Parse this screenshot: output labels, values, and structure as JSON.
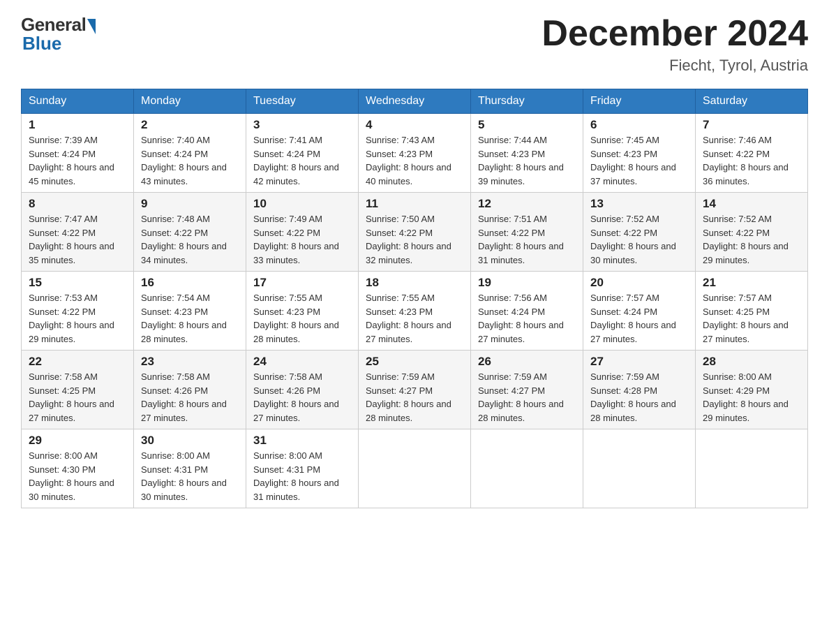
{
  "header": {
    "logo": {
      "general": "General",
      "blue": "Blue"
    },
    "title": "December 2024",
    "location": "Fiecht, Tyrol, Austria"
  },
  "days_of_week": [
    "Sunday",
    "Monday",
    "Tuesday",
    "Wednesday",
    "Thursday",
    "Friday",
    "Saturday"
  ],
  "weeks": [
    [
      {
        "day": "1",
        "sunrise": "7:39 AM",
        "sunset": "4:24 PM",
        "daylight": "8 hours and 45 minutes."
      },
      {
        "day": "2",
        "sunrise": "7:40 AM",
        "sunset": "4:24 PM",
        "daylight": "8 hours and 43 minutes."
      },
      {
        "day": "3",
        "sunrise": "7:41 AM",
        "sunset": "4:24 PM",
        "daylight": "8 hours and 42 minutes."
      },
      {
        "day": "4",
        "sunrise": "7:43 AM",
        "sunset": "4:23 PM",
        "daylight": "8 hours and 40 minutes."
      },
      {
        "day": "5",
        "sunrise": "7:44 AM",
        "sunset": "4:23 PM",
        "daylight": "8 hours and 39 minutes."
      },
      {
        "day": "6",
        "sunrise": "7:45 AM",
        "sunset": "4:23 PM",
        "daylight": "8 hours and 37 minutes."
      },
      {
        "day": "7",
        "sunrise": "7:46 AM",
        "sunset": "4:22 PM",
        "daylight": "8 hours and 36 minutes."
      }
    ],
    [
      {
        "day": "8",
        "sunrise": "7:47 AM",
        "sunset": "4:22 PM",
        "daylight": "8 hours and 35 minutes."
      },
      {
        "day": "9",
        "sunrise": "7:48 AM",
        "sunset": "4:22 PM",
        "daylight": "8 hours and 34 minutes."
      },
      {
        "day": "10",
        "sunrise": "7:49 AM",
        "sunset": "4:22 PM",
        "daylight": "8 hours and 33 minutes."
      },
      {
        "day": "11",
        "sunrise": "7:50 AM",
        "sunset": "4:22 PM",
        "daylight": "8 hours and 32 minutes."
      },
      {
        "day": "12",
        "sunrise": "7:51 AM",
        "sunset": "4:22 PM",
        "daylight": "8 hours and 31 minutes."
      },
      {
        "day": "13",
        "sunrise": "7:52 AM",
        "sunset": "4:22 PM",
        "daylight": "8 hours and 30 minutes."
      },
      {
        "day": "14",
        "sunrise": "7:52 AM",
        "sunset": "4:22 PM",
        "daylight": "8 hours and 29 minutes."
      }
    ],
    [
      {
        "day": "15",
        "sunrise": "7:53 AM",
        "sunset": "4:22 PM",
        "daylight": "8 hours and 29 minutes."
      },
      {
        "day": "16",
        "sunrise": "7:54 AM",
        "sunset": "4:23 PM",
        "daylight": "8 hours and 28 minutes."
      },
      {
        "day": "17",
        "sunrise": "7:55 AM",
        "sunset": "4:23 PM",
        "daylight": "8 hours and 28 minutes."
      },
      {
        "day": "18",
        "sunrise": "7:55 AM",
        "sunset": "4:23 PM",
        "daylight": "8 hours and 27 minutes."
      },
      {
        "day": "19",
        "sunrise": "7:56 AM",
        "sunset": "4:24 PM",
        "daylight": "8 hours and 27 minutes."
      },
      {
        "day": "20",
        "sunrise": "7:57 AM",
        "sunset": "4:24 PM",
        "daylight": "8 hours and 27 minutes."
      },
      {
        "day": "21",
        "sunrise": "7:57 AM",
        "sunset": "4:25 PM",
        "daylight": "8 hours and 27 minutes."
      }
    ],
    [
      {
        "day": "22",
        "sunrise": "7:58 AM",
        "sunset": "4:25 PM",
        "daylight": "8 hours and 27 minutes."
      },
      {
        "day": "23",
        "sunrise": "7:58 AM",
        "sunset": "4:26 PM",
        "daylight": "8 hours and 27 minutes."
      },
      {
        "day": "24",
        "sunrise": "7:58 AM",
        "sunset": "4:26 PM",
        "daylight": "8 hours and 27 minutes."
      },
      {
        "day": "25",
        "sunrise": "7:59 AM",
        "sunset": "4:27 PM",
        "daylight": "8 hours and 28 minutes."
      },
      {
        "day": "26",
        "sunrise": "7:59 AM",
        "sunset": "4:27 PM",
        "daylight": "8 hours and 28 minutes."
      },
      {
        "day": "27",
        "sunrise": "7:59 AM",
        "sunset": "4:28 PM",
        "daylight": "8 hours and 28 minutes."
      },
      {
        "day": "28",
        "sunrise": "8:00 AM",
        "sunset": "4:29 PM",
        "daylight": "8 hours and 29 minutes."
      }
    ],
    [
      {
        "day": "29",
        "sunrise": "8:00 AM",
        "sunset": "4:30 PM",
        "daylight": "8 hours and 30 minutes."
      },
      {
        "day": "30",
        "sunrise": "8:00 AM",
        "sunset": "4:31 PM",
        "daylight": "8 hours and 30 minutes."
      },
      {
        "day": "31",
        "sunrise": "8:00 AM",
        "sunset": "4:31 PM",
        "daylight": "8 hours and 31 minutes."
      },
      null,
      null,
      null,
      null
    ]
  ]
}
